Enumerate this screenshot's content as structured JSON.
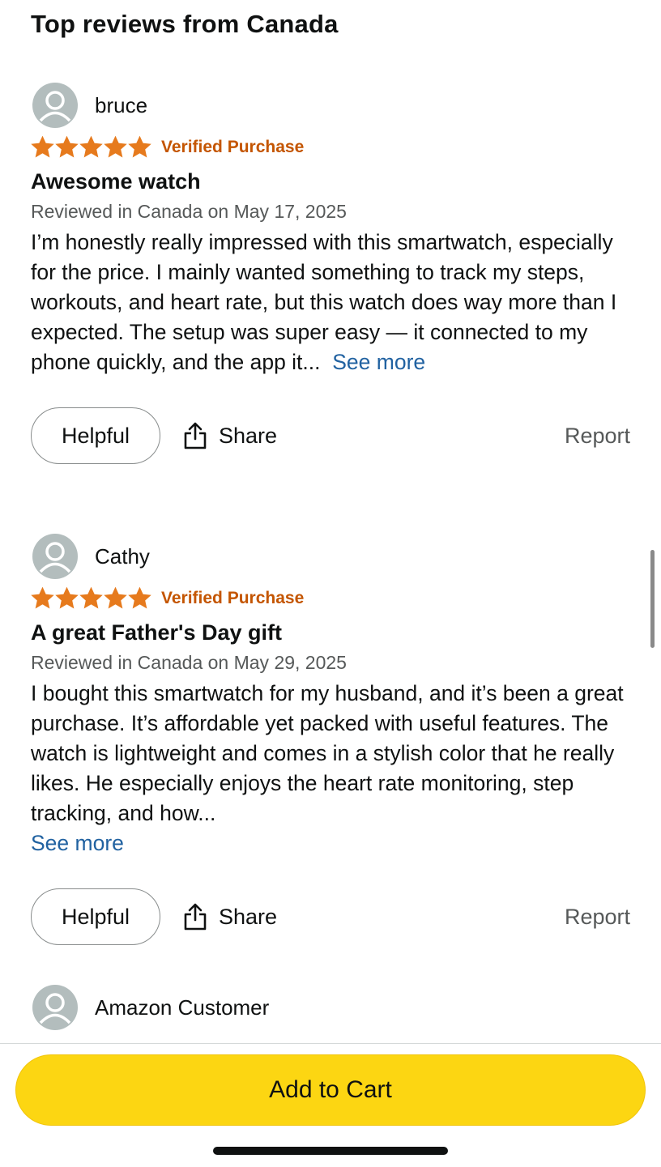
{
  "page_title": "Top reviews from Canada",
  "colors": {
    "star": "#e67a1d",
    "verified": "#c45500",
    "link": "#2162a1",
    "cart_button": "#fcd612"
  },
  "reviews": [
    {
      "reviewer": "bruce",
      "avatar_icon": "person-avatar-icon",
      "rating": 5,
      "rating_max": 5,
      "verified_label": "Verified Purchase",
      "title": "Awesome watch",
      "date": "Reviewed in Canada on May 17, 2025",
      "body": "I’m honestly really impressed with this smartwatch, especially for the price. I mainly wanted something to track my steps, workouts, and heart rate, but this watch does way more than I expected. The setup was super easy — it connected to my phone quickly, and the app it...",
      "see_more": "See more",
      "helpful_label": "Helpful",
      "share_label": "Share",
      "report_label": "Report"
    },
    {
      "reviewer": "Cathy",
      "avatar_icon": "person-avatar-icon",
      "rating": 5,
      "rating_max": 5,
      "verified_label": "Verified Purchase",
      "title": "A great Father's Day gift",
      "date": "Reviewed in Canada on May 29, 2025",
      "body": "I bought this smartwatch for my husband, and it’s been a great purchase. It’s affordable yet packed with useful features. The watch is lightweight and comes in a stylish color that he really likes. He especially enjoys the heart rate monitoring, step tracking, and how...",
      "see_more": "See more",
      "helpful_label": "Helpful",
      "share_label": "Share",
      "report_label": "Report"
    },
    {
      "reviewer": "Amazon Customer",
      "avatar_icon": "person-avatar-icon"
    }
  ],
  "footer": {
    "add_to_cart": "Add to Cart"
  }
}
